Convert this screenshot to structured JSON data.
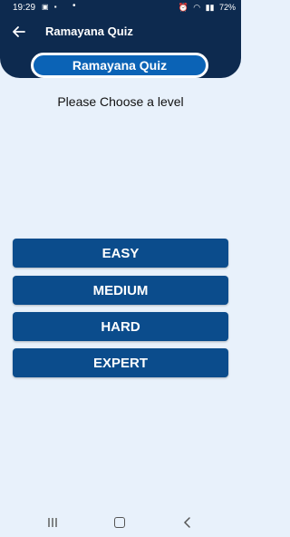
{
  "status_bar": {
    "time": "19:29",
    "battery": "72%"
  },
  "header": {
    "title": "Ramayana Quiz",
    "pill_title": "Ramayana Quiz"
  },
  "prompt": "Please Choose a level",
  "levels": [
    {
      "label": "EASY"
    },
    {
      "label": "MEDIUM"
    },
    {
      "label": "HARD"
    },
    {
      "label": "EXPERT"
    }
  ],
  "colors": {
    "header_bg": "#0d2a4f",
    "pill_bg": "#0b63b6",
    "button_bg": "#0b4c8c",
    "page_bg": "#e8f1fb"
  },
  "icons": {
    "back": "arrow-left-icon",
    "nav_recents": "recents-icon",
    "nav_home": "home-icon",
    "nav_back": "back-chevron-icon"
  }
}
